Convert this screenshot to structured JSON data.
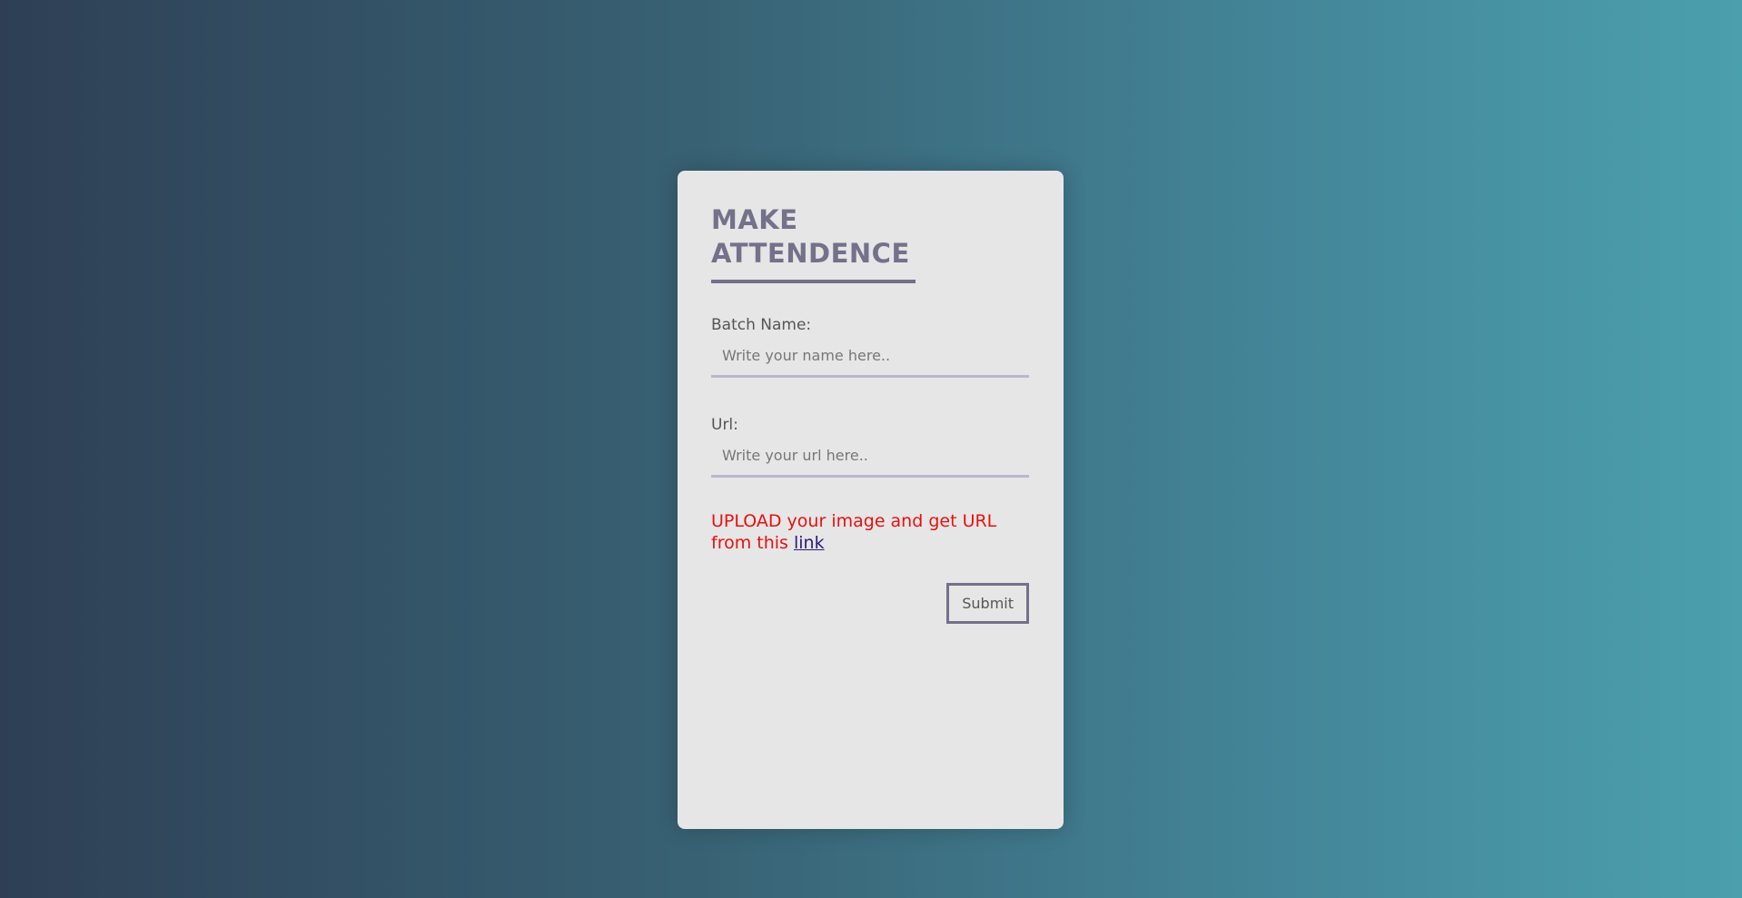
{
  "form": {
    "title_line1": "MAKE",
    "title_line2": "ATTENDENCE",
    "batch_name": {
      "label": "Batch Name:",
      "placeholder": "Write your name here..",
      "value": ""
    },
    "url": {
      "label": "Url:",
      "placeholder": "Write your url here..",
      "value": ""
    },
    "upload_note": {
      "text": "UPLOAD your image and get URL from this",
      "link_text": "link"
    },
    "submit_label": "Submit"
  },
  "colors": {
    "background_start": "#2e3f55",
    "background_end": "#4ba0ad",
    "card": "#e6e6e6",
    "title": "#74718a",
    "note": "#e81010",
    "link": "#2f1a7a"
  }
}
